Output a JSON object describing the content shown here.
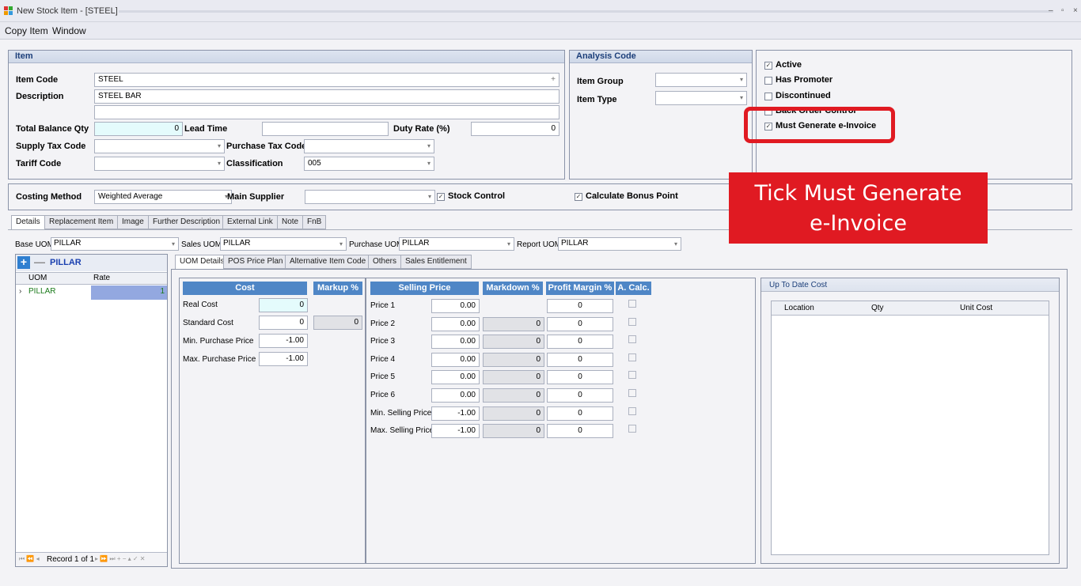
{
  "window": {
    "title": "New Stock Item - [STEEL]",
    "controls": [
      "–",
      "▫",
      "×"
    ]
  },
  "menu": {
    "items": [
      "Copy Item",
      "Window"
    ]
  },
  "item_group": {
    "header": "Item",
    "item_code_label": "Item Code",
    "item_code": "STEEL",
    "item_code_plus": "+",
    "description_label": "Description",
    "description": "STEEL BAR",
    "description2": "",
    "total_balance_qty_label": "Total Balance Qty",
    "total_balance_qty": "0",
    "lead_time_label": "Lead Time",
    "lead_time": "",
    "duty_rate_label": "Duty Rate (%)",
    "duty_rate": "0",
    "supply_tax_code_label": "Supply Tax Code",
    "supply_tax_code": "",
    "purchase_tax_code_label": "Purchase Tax Code",
    "purchase_tax_code": "",
    "tariff_code_label": "Tariff Code",
    "tariff_code": "",
    "classification_label": "Classification",
    "classification": "005"
  },
  "analysis_code": {
    "header": "Analysis Code",
    "item_group_label": "Item Group",
    "item_group": "",
    "item_type_label": "Item Type",
    "item_type": ""
  },
  "flags": {
    "active": {
      "label": "Active",
      "checked": true
    },
    "has_promoter": {
      "label": "Has Promoter",
      "checked": false
    },
    "discontinued": {
      "label": "Discontinued",
      "checked": false
    },
    "back_order_control": {
      "label": "Back Order Control",
      "checked": false
    },
    "must_generate_einvoice": {
      "label": "Must Generate e-Invoice",
      "checked": true
    }
  },
  "costing": {
    "costing_method_label": "Costing Method",
    "costing_method": "Weighted Average",
    "main_supplier_label": "Main Supplier",
    "main_supplier": "",
    "stock_control_label": "Stock Control",
    "stock_control": true,
    "calc_bonus_label": "Calculate Bonus Point",
    "calc_bonus": true
  },
  "main_tabs": [
    "Details",
    "Replacement Item",
    "Image",
    "Further Description",
    "External Link",
    "Note",
    "FnB"
  ],
  "uom_selects": {
    "base_uom_label": "Base UOM",
    "base_uom": "PILLAR",
    "sales_uom_label": "Sales UOM",
    "sales_uom": "PILLAR",
    "purchase_uom_label": "Purchase UOM",
    "purchase_uom": "PILLAR",
    "report_uom_label": "Report UOM",
    "report_uom": "PILLAR"
  },
  "uom_list": {
    "current": "PILLAR",
    "columns": [
      "UOM",
      "Rate"
    ],
    "rows": [
      {
        "uom": "PILLAR",
        "rate": "1"
      }
    ],
    "navigator": "Record 1 of 1"
  },
  "sub_tabs": [
    "UOM Details",
    "POS Price Plan",
    "Alternative Item Code",
    "Others",
    "Sales Entitlement"
  ],
  "cost_panel": {
    "cost_header": "Cost",
    "markup_header": "Markup %",
    "rows": [
      {
        "label": "Real Cost",
        "value": "0"
      },
      {
        "label": "Standard Cost",
        "value": "0",
        "markup": "0"
      },
      {
        "label": "Min. Purchase Price",
        "value": "-1.00"
      },
      {
        "label": "Max. Purchase Price",
        "value": "-1.00"
      }
    ]
  },
  "price_panel": {
    "selling_header": "Selling Price",
    "markdown_header": "Markdown %",
    "margin_header": "Profit Margin %",
    "acalc_header": "A. Calc.",
    "rows": [
      {
        "label": "Price 1",
        "price": "0.00",
        "markdown": "",
        "margin": "0"
      },
      {
        "label": "Price 2",
        "price": "0.00",
        "markdown": "0",
        "margin": "0"
      },
      {
        "label": "Price 3",
        "price": "0.00",
        "markdown": "0",
        "margin": "0"
      },
      {
        "label": "Price 4",
        "price": "0.00",
        "markdown": "0",
        "margin": "0"
      },
      {
        "label": "Price 5",
        "price": "0.00",
        "markdown": "0",
        "margin": "0"
      },
      {
        "label": "Price 6",
        "price": "0.00",
        "markdown": "0",
        "margin": "0"
      },
      {
        "label": "Min. Selling Price",
        "price": "-1.00",
        "markdown": "0",
        "margin": "0"
      },
      {
        "label": "Max. Selling Price",
        "price": "-1.00",
        "markdown": "0",
        "margin": "0"
      }
    ]
  },
  "up_to_date_cost": {
    "header": "Up To Date Cost",
    "columns": [
      "Location",
      "Qty",
      "Unit Cost"
    ]
  },
  "annotation": {
    "line1": "Tick Must Generate",
    "line2": "e-Invoice",
    "color": "#e01a22"
  }
}
